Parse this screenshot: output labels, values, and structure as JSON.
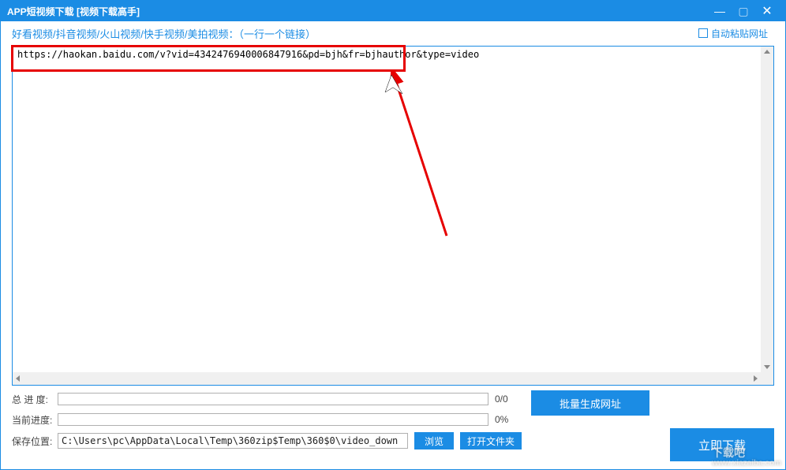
{
  "titlebar": {
    "title": "APP短视频下载 [视频下载高手]"
  },
  "header": {
    "desc": "好看视频/抖音视频/火山视频/快手视频/美拍视频：（一行一个链接）",
    "autopaste": "自动粘贴网址"
  },
  "textarea": {
    "value": "https://haokan.baidu.com/v?vid=4342476940006847916&pd=bjh&fr=bjhauthor&type=video"
  },
  "progress": {
    "total_label": "总 进 度:",
    "total_value": "0/0",
    "current_label": "当前进度:",
    "current_value": "0%"
  },
  "path": {
    "label": "保存位置:",
    "value": "C:\\Users\\pc\\AppData\\Local\\Temp\\360zip$Temp\\360$0\\video_down",
    "browse": "浏览",
    "open": "打开文件夹"
  },
  "buttons": {
    "gen": "批量生成网址",
    "download": "立即下载"
  },
  "watermark": {
    "main": "下载吧",
    "sub": "www.xiazaiba.com"
  }
}
